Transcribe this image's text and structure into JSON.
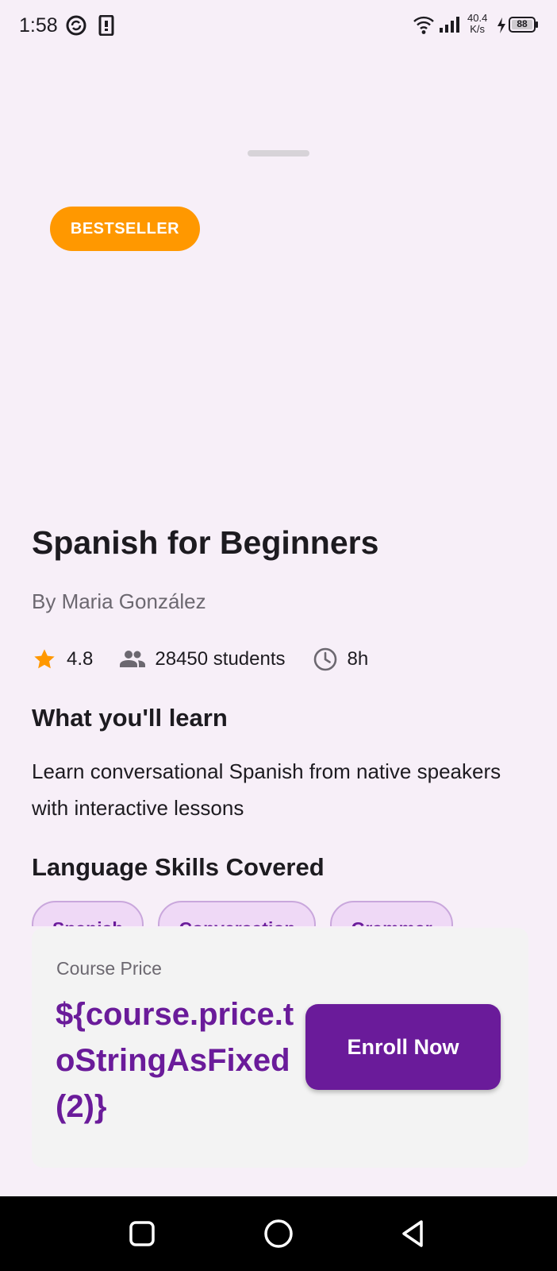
{
  "status_bar": {
    "time": "1:58",
    "net_speed_value": "40.4",
    "net_speed_unit": "K/s",
    "battery": "88",
    "icons": [
      "sync-icon",
      "sim-card-icon",
      "wifi-icon",
      "signal-icon",
      "charging-icon",
      "battery-icon"
    ]
  },
  "course": {
    "badge": "BESTSELLER",
    "title": "Spanish for Beginners",
    "author": "By Maria González",
    "rating": "4.8",
    "students": "28450 students",
    "duration": "8h",
    "learn_heading": "What you'll learn",
    "description": "Learn conversational Spanish from native speakers with interactive lessons",
    "skills_heading": "Language Skills Covered",
    "skills": [
      "Spanish",
      "Conversation",
      "Grammar"
    ]
  },
  "purchase": {
    "price_label": "Course Price",
    "price_value": "${course.price.toStringAsFixed(2)}",
    "enroll_label": "Enroll Now"
  },
  "colors": {
    "background": "#f7eff8",
    "accent": "#6a1b9a",
    "badge": "#ff9800",
    "star": "#ff9800"
  },
  "nav_bar": {
    "buttons": [
      "recent-apps-icon",
      "home-icon",
      "back-icon"
    ]
  }
}
